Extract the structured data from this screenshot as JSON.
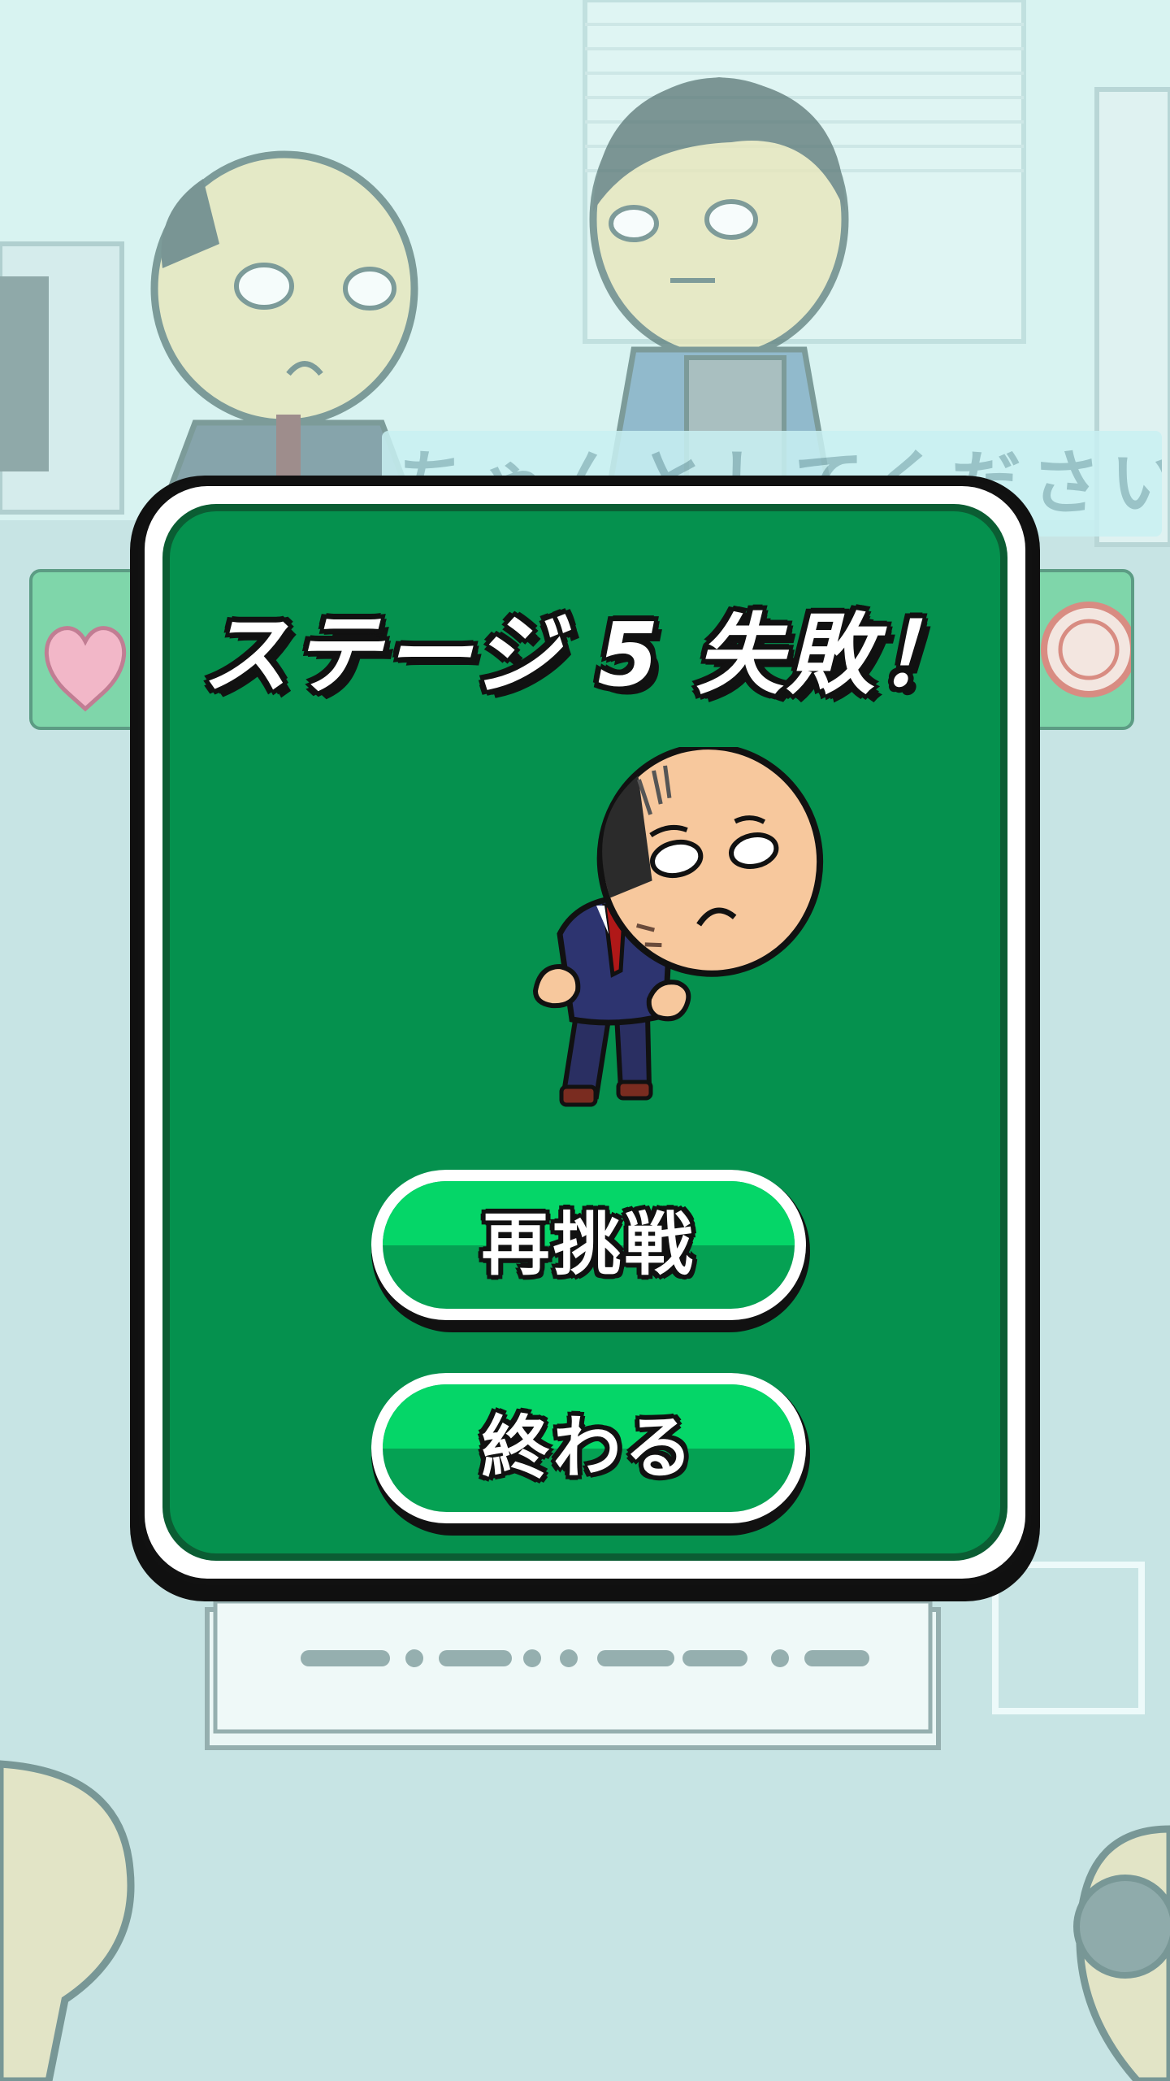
{
  "background": {
    "speech_text": "ちゃんとしてください！",
    "colors": {
      "sky": "#d7f1ef",
      "wall": "#c6e5e5"
    }
  },
  "dialog": {
    "title": "ステージ 5 失敗！",
    "character": "sad-bald-salaryman",
    "buttons": {
      "retry_label": "再挑戦",
      "quit_label": "終わる"
    },
    "colors": {
      "panel": "#05914e",
      "panel_border": "#0b5d33",
      "button_top": "#05d668",
      "button_bottom": "#05a153"
    }
  },
  "hud": {
    "left_icon": "heart-icon",
    "right_icon": "stamp-icon"
  }
}
